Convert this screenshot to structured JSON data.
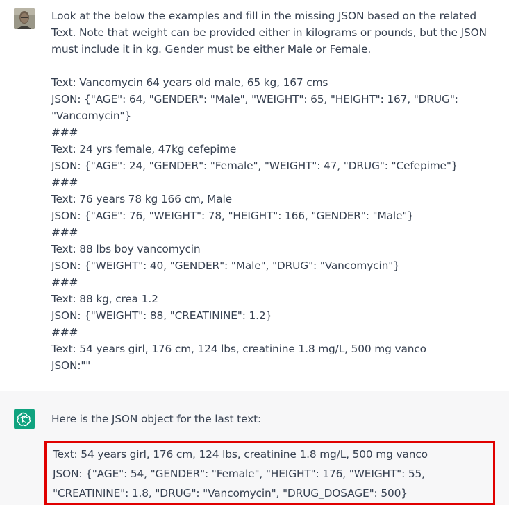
{
  "conversation": {
    "user_message": {
      "text": "Look at the below the examples and fill in the missing JSON based on the related Text. Note that weight can be provided either in kilograms or pounds, but the JSON must include it in kg. Gender must be either Male or Female.\n\nText: Vancomycin 64 years old male, 65 kg, 167 cms\nJSON: {\"AGE\": 64, \"GENDER\": \"Male\", \"WEIGHT\": 65, \"HEIGHT\": 167, \"DRUG\": \"Vancomycin\"}\n###\nText: 24 yrs female, 47kg cefepime\nJSON: {\"AGE\": 24, \"GENDER\": \"Female\", \"WEIGHT\": 47, \"DRUG\": \"Cefepime\"}\n###\nText: 76 years 78 kg 166 cm, Male\nJSON: {\"AGE\": 76, \"WEIGHT\": 78, \"HEIGHT\": 166, \"GENDER\": \"Male\"}\n###\nText: 88 lbs boy vancomycin\nJSON: {\"WEIGHT\": 40, \"GENDER\": \"Male\", \"DRUG\": \"Vancomycin\"}\n###\nText: 88 kg, crea 1.2\nJSON: {\"WEIGHT\": 88, \"CREATININE\": 1.2}\n###\nText: 54 years girl, 176 cm, 124 lbs, creatinine 1.8 mg/L, 500 mg vanco\nJSON:\"\"",
      "avatar_icon": "user-photo-avatar"
    },
    "assistant_message": {
      "intro": "Here is the JSON object for the last text:",
      "highlighted_text": "Text: 54 years girl, 176 cm, 124 lbs, creatinine 1.8 mg/L, 500 mg vanco\nJSON: {\"AGE\": 54, \"GENDER\": \"Female\", \"HEIGHT\": 176, \"WEIGHT\": 55, \"CREATININE\": 1.8, \"DRUG\": \"Vancomycin\", \"DRUG_DOSAGE\": 500}",
      "avatar_icon": "openai-logo-icon",
      "avatar_color": "#10a37f",
      "highlight_color": "#e00000"
    }
  }
}
